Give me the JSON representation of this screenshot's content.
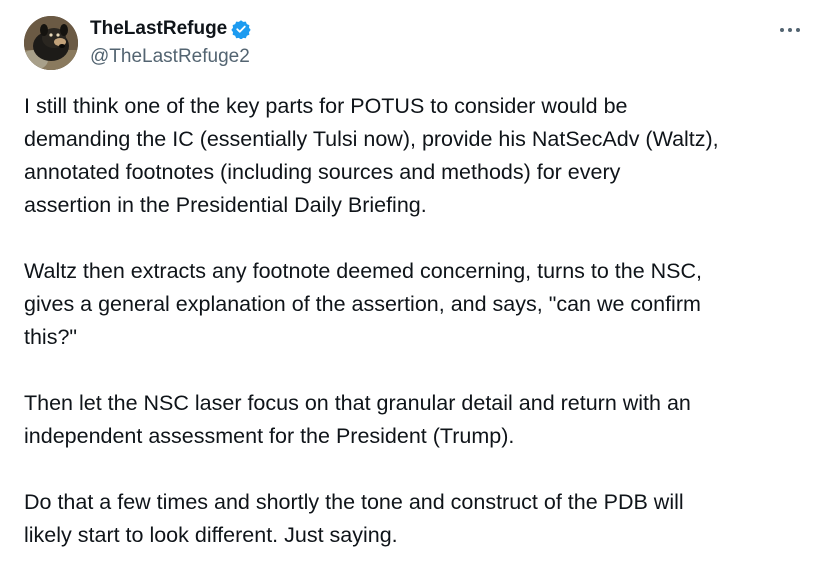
{
  "author": {
    "display_name": "TheLastRefuge",
    "handle": "@TheLastRefuge2",
    "verified": true,
    "verified_color": "#1d9bf0"
  },
  "icons": {
    "avatar": "avatar-dog-photo",
    "verified": "verified-badge-icon",
    "more": "more-options-icon"
  },
  "tweet": {
    "paragraphs": [
      "I still think one of the key parts for POTUS to consider would be\ndemanding the IC (essentially Tulsi now), provide his NatSecAdv (Waltz),\nannotated footnotes (including sources and methods) for every\nassertion in the Presidential Daily Briefing.",
      "Waltz then extracts any footnote deemed concerning, turns to the NSC,\ngives a general explanation of the assertion, and says, \"can we confirm\nthis?\"",
      "Then let the NSC laser focus on that granular detail and return with an\nindependent assessment for the President (Trump).",
      "Do that a few times and shortly the tone and construct of the PDB will\nlikely start to look different.  Just saying."
    ]
  },
  "colors": {
    "text": "#0f1419",
    "secondary": "#536471",
    "background": "#ffffff"
  }
}
